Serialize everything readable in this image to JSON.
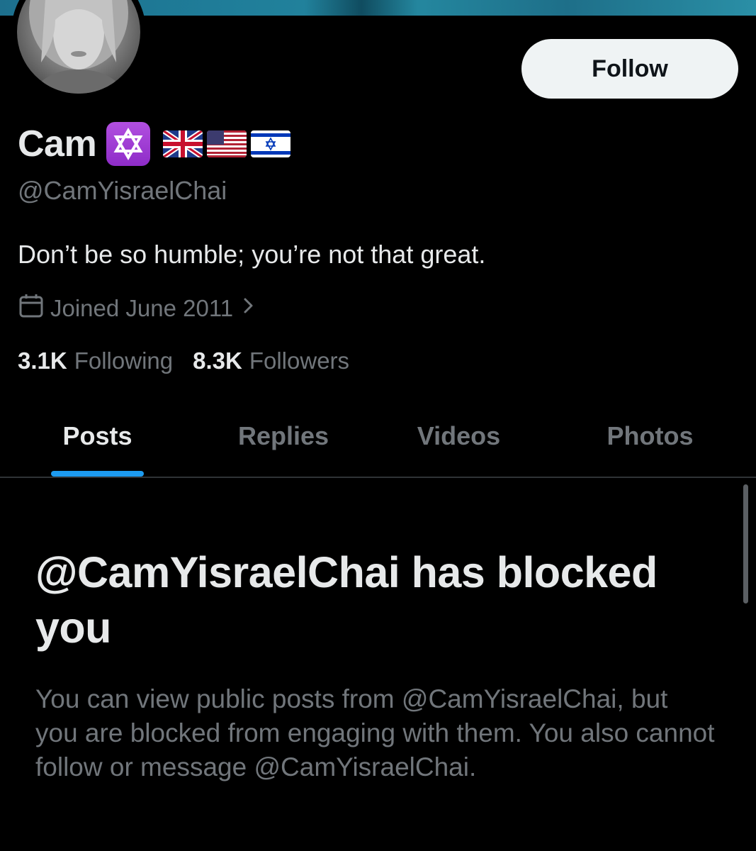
{
  "profile": {
    "display_name": "Cam",
    "handle": "@CamYisraelChai",
    "bio": "Don’t be so humble; you’re not that great.",
    "joined": "Joined June 2011",
    "badge_icon": "star-of-david-icon",
    "flags": [
      "uk-flag-icon",
      "us-flag-icon",
      "israel-flag-icon"
    ]
  },
  "actions": {
    "follow_label": "Follow"
  },
  "stats": {
    "following_count": "3.1K",
    "following_label": "Following",
    "followers_count": "8.3K",
    "followers_label": "Followers"
  },
  "tabs": [
    {
      "label": "Posts",
      "active": true
    },
    {
      "label": "Replies",
      "active": false
    },
    {
      "label": "Videos",
      "active": false
    },
    {
      "label": "Photos",
      "active": false
    }
  ],
  "block_notice": {
    "title": "@CamYisraelChai has blocked you",
    "body": "You can view public posts from @CamYisraelChai, but you are blocked from engaging with them. You also cannot follow or message @CamYisraelChai."
  },
  "colors": {
    "background": "#000000",
    "primary_text": "#e7e9ea",
    "secondary_text": "#71767b",
    "accent": "#1d9bf0",
    "button_bg": "#eff3f4",
    "divider": "#2f3336",
    "badge": "#9b3bd4"
  }
}
